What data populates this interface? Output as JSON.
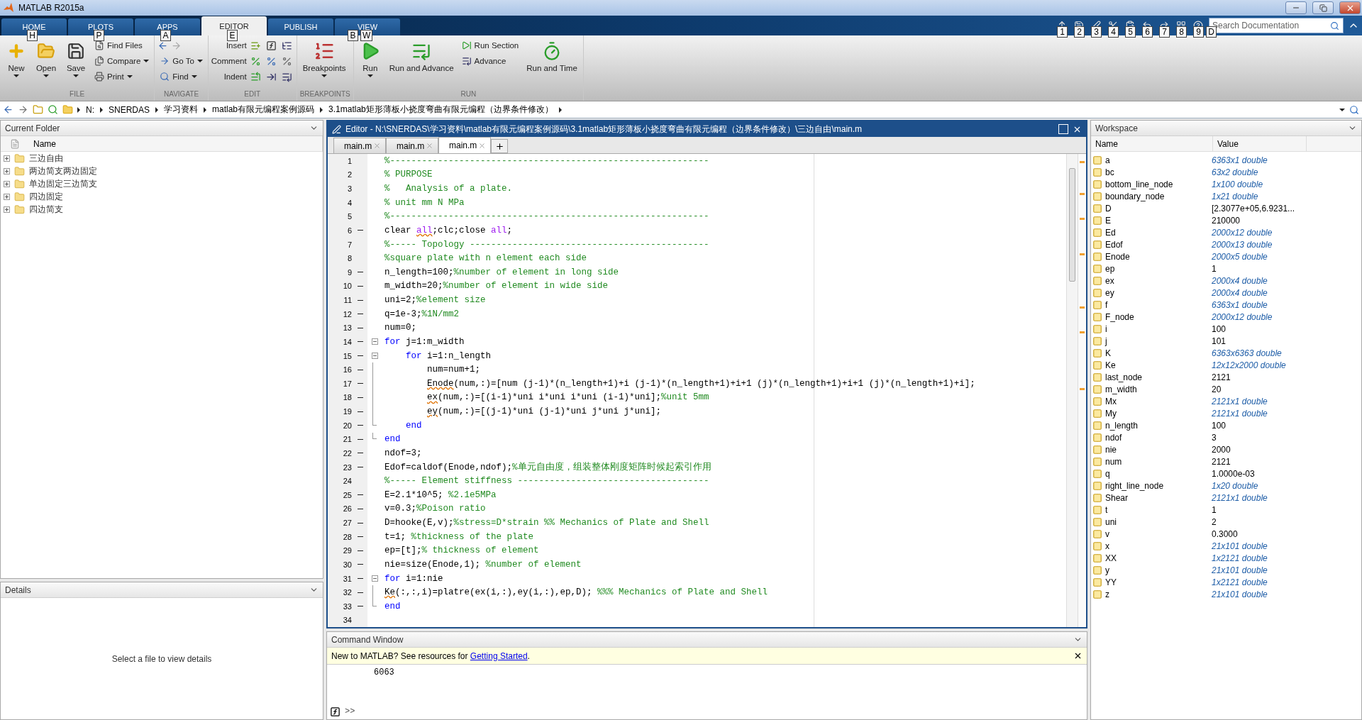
{
  "window": {
    "title": "MATLAB R2015a"
  },
  "ribbon_tabs": [
    {
      "label": "HOME",
      "keytip": "H",
      "selected": false
    },
    {
      "label": "PLOTS",
      "keytip": "P",
      "selected": false
    },
    {
      "label": "APPS",
      "keytip": "A",
      "selected": false
    },
    {
      "label": "EDITOR",
      "keytip": "E",
      "selected": true
    },
    {
      "label": "PUBLISH",
      "keytip": "B",
      "selected": false
    },
    {
      "label": "VIEW",
      "keytip": "W",
      "selected": false
    }
  ],
  "quick_access": {
    "keytips": [
      "1",
      "2",
      "3",
      "4",
      "5",
      "6",
      "7",
      "8",
      "9"
    ],
    "search_placeholder": "Search Documentation",
    "search_keytip": "D"
  },
  "ribbon_groups": [
    {
      "label": "FILE",
      "items": [
        {
          "kind": "large",
          "label": "New",
          "caret": true
        },
        {
          "kind": "large",
          "label": "Open",
          "caret": true
        },
        {
          "kind": "large",
          "label": "Save",
          "caret": true
        },
        {
          "kind": "small",
          "label": "Find Files",
          "caret": false
        },
        {
          "kind": "small",
          "label": "Compare",
          "caret": true
        },
        {
          "kind": "small",
          "label": "Print",
          "caret": true
        }
      ]
    },
    {
      "label": "NAVIGATE",
      "items": [
        {
          "kind": "arrows"
        },
        {
          "kind": "small",
          "label": "Go To",
          "caret": true
        },
        {
          "kind": "small",
          "label": "Find",
          "caret": true
        }
      ]
    },
    {
      "label": "EDIT",
      "items": [
        {
          "kind": "row",
          "label": "Insert"
        },
        {
          "kind": "row",
          "label": "Comment"
        },
        {
          "kind": "row",
          "label": "Indent"
        }
      ]
    },
    {
      "label": "BREAKPOINTS",
      "items": [
        {
          "kind": "large",
          "label": "Breakpoints",
          "caret": true
        }
      ]
    },
    {
      "label": "RUN",
      "items": [
        {
          "kind": "large",
          "label": "Run",
          "caret": true
        },
        {
          "kind": "large",
          "label": "Run and Advance",
          "caret": false
        },
        {
          "kind": "small",
          "label": "Run Section",
          "caret": false
        },
        {
          "kind": "small",
          "label": "Advance",
          "caret": false
        },
        {
          "kind": "large",
          "label": "Run and Time",
          "caret": false
        }
      ]
    }
  ],
  "address_path": [
    "N:",
    "SNERDAS",
    "学习资料",
    "matlab有限元编程案例源码",
    "3.1matlab矩形薄板小挠度弯曲有限元编程（边界条件修改）"
  ],
  "current_folder": {
    "title": "Current Folder",
    "column": "Name",
    "items": [
      {
        "name": "三边自由",
        "expanded": false
      },
      {
        "name": "两边简支两边固定",
        "expanded": false
      },
      {
        "name": "单边固定三边简支",
        "expanded": false
      },
      {
        "name": "四边固定",
        "expanded": false
      },
      {
        "name": "四边简支",
        "expanded": false
      }
    ]
  },
  "details": {
    "title": "Details",
    "message": "Select a file to view details"
  },
  "editor": {
    "title": "Editor - N:\\SNERDAS\\学习资料\\matlab有限元编程案例源码\\3.1matlab矩形薄板小挠度弯曲有限元编程（边界条件修改）\\三边自由\\main.m",
    "tabs": [
      {
        "label": "main.m",
        "selected": false
      },
      {
        "label": "main.m",
        "selected": false
      },
      {
        "label": "main.m",
        "selected": true
      }
    ],
    "lines": [
      {
        "number": "1",
        "kind": "plain",
        "executable": false,
        "segments": [
          {
            "kind": "comment",
            "text": "%------------------------------------------------------------"
          }
        ]
      },
      {
        "number": "2",
        "kind": "plain",
        "executable": false,
        "segments": [
          {
            "kind": "comment",
            "text": "% PURPOSE"
          }
        ]
      },
      {
        "number": "3",
        "kind": "plain",
        "executable": false,
        "segments": [
          {
            "kind": "comment",
            "text": "%   Analysis of a plate."
          }
        ]
      },
      {
        "number": "4",
        "kind": "plain",
        "executable": false,
        "segments": [
          {
            "kind": "comment",
            "text": "% unit mm N MPa"
          }
        ]
      },
      {
        "number": "5",
        "kind": "plain",
        "executable": false,
        "segments": [
          {
            "kind": "comment",
            "text": "%------------------------------------------------------------"
          }
        ]
      },
      {
        "number": "6",
        "kind": "plain",
        "executable": true,
        "segments": [
          {
            "kind": "code",
            "text": "clear "
          },
          {
            "kind": "flagged_string",
            "text": "all"
          },
          {
            "kind": "code",
            "text": ";clc;close "
          },
          {
            "kind": "string",
            "text": "all"
          },
          {
            "kind": "code",
            "text": ";"
          }
        ]
      },
      {
        "number": "7",
        "kind": "plain",
        "executable": false,
        "segments": [
          {
            "kind": "comment",
            "text": "%----- Topology ---------------------------------------------"
          }
        ]
      },
      {
        "number": "8",
        "kind": "plain",
        "executable": false,
        "segments": [
          {
            "kind": "comment",
            "text": "%square plate with n element each side"
          }
        ]
      },
      {
        "number": "9",
        "kind": "plain",
        "executable": true,
        "segments": [
          {
            "kind": "code",
            "text": "n_length=100;"
          },
          {
            "kind": "comment",
            "text": "%number of element in long side"
          }
        ]
      },
      {
        "number": "10",
        "kind": "plain",
        "executable": true,
        "segments": [
          {
            "kind": "code",
            "text": "m_width=20;"
          },
          {
            "kind": "comment",
            "text": "%number of element in wide side"
          }
        ]
      },
      {
        "number": "11",
        "kind": "plain",
        "executable": true,
        "segments": [
          {
            "kind": "code",
            "text": "uni=2;"
          },
          {
            "kind": "comment",
            "text": "%element size"
          }
        ]
      },
      {
        "number": "12",
        "kind": "plain",
        "executable": true,
        "segments": [
          {
            "kind": "code",
            "text": "q=1e-3;"
          },
          {
            "kind": "comment",
            "text": "%1N/mm2"
          }
        ]
      },
      {
        "number": "13",
        "kind": "plain",
        "executable": true,
        "segments": [
          {
            "kind": "code",
            "text": "num=0;"
          }
        ]
      },
      {
        "number": "14",
        "kind": "opener",
        "executable": true,
        "segments": [
          {
            "kind": "keyword",
            "text": "for"
          },
          {
            "kind": "code",
            "text": " j=1:m_width"
          }
        ]
      },
      {
        "number": "15",
        "kind": "opener",
        "executable": true,
        "segments": [
          {
            "kind": "keyword",
            "text": "    for"
          },
          {
            "kind": "code",
            "text": " i=1:n_length"
          }
        ]
      },
      {
        "number": "16",
        "kind": "inner",
        "executable": true,
        "segments": [
          {
            "kind": "code",
            "text": "        num=num+1;"
          }
        ]
      },
      {
        "number": "17",
        "kind": "inner",
        "executable": true,
        "segments": [
          {
            "kind": "flagged",
            "text": "        Enode"
          },
          {
            "kind": "code",
            "text": "(num,:)=[num (j-1)*(n_length+1)+i (j-1)*(n_length+1)+i+1 (j)*(n_length+1)+i+1 (j)*(n_length+1)+i];"
          }
        ]
      },
      {
        "number": "18",
        "kind": "inner",
        "executable": true,
        "segments": [
          {
            "kind": "flagged",
            "text": "        ex"
          },
          {
            "kind": "code",
            "text": "(num,:)=[(i-1)*uni i*uni i*uni (i-1)*uni];"
          },
          {
            "kind": "comment",
            "text": "%unit 5mm"
          }
        ]
      },
      {
        "number": "19",
        "kind": "inner",
        "executable": true,
        "segments": [
          {
            "kind": "flagged",
            "text": "        ey"
          },
          {
            "kind": "code",
            "text": "(num,:)=[(j-1)*uni (j-1)*uni j*uni j*uni];"
          }
        ]
      },
      {
        "number": "20",
        "kind": "closer",
        "executable": true,
        "segments": [
          {
            "kind": "keyword",
            "text": "    end"
          }
        ]
      },
      {
        "number": "21",
        "kind": "closer",
        "executable": true,
        "segments": [
          {
            "kind": "keyword",
            "text": "end"
          }
        ]
      },
      {
        "number": "22",
        "kind": "plain",
        "executable": true,
        "segments": [
          {
            "kind": "code",
            "text": "ndof=3;"
          }
        ]
      },
      {
        "number": "23",
        "kind": "plain",
        "executable": true,
        "segments": [
          {
            "kind": "code",
            "text": "Edof=caldof(Enode,ndof);"
          },
          {
            "kind": "comment",
            "text": "%单元自由度，组装整体刚度矩阵时候起索引作用"
          }
        ]
      },
      {
        "number": "24",
        "kind": "plain",
        "executable": false,
        "segments": [
          {
            "kind": "comment",
            "text": "%----- Element stiffness ------------------------------------"
          }
        ]
      },
      {
        "number": "25",
        "kind": "plain",
        "executable": true,
        "segments": [
          {
            "kind": "code",
            "text": "E=2.1*10^5; "
          },
          {
            "kind": "comment",
            "text": "%2.1e5MPa"
          }
        ]
      },
      {
        "number": "26",
        "kind": "plain",
        "executable": true,
        "segments": [
          {
            "kind": "code",
            "text": "v=0.3;"
          },
          {
            "kind": "comment",
            "text": "%Poison ratio"
          }
        ]
      },
      {
        "number": "27",
        "kind": "plain",
        "executable": true,
        "segments": [
          {
            "kind": "code",
            "text": "D=hooke(E,v);"
          },
          {
            "kind": "comment",
            "text": "%stress=D*strain %% Mechanics of Plate and Shell"
          }
        ]
      },
      {
        "number": "28",
        "kind": "plain",
        "executable": true,
        "segments": [
          {
            "kind": "code",
            "text": "t=1; "
          },
          {
            "kind": "comment",
            "text": "%thickness of the plate"
          }
        ]
      },
      {
        "number": "29",
        "kind": "plain",
        "executable": true,
        "segments": [
          {
            "kind": "code",
            "text": "ep=[t];"
          },
          {
            "kind": "comment",
            "text": "% thickness of element"
          }
        ]
      },
      {
        "number": "30",
        "kind": "plain",
        "executable": true,
        "segments": [
          {
            "kind": "code",
            "text": "nie=size(Enode,1); "
          },
          {
            "kind": "comment",
            "text": "%number of element"
          }
        ]
      },
      {
        "number": "31",
        "kind": "opener",
        "executable": true,
        "segments": [
          {
            "kind": "keyword",
            "text": "for"
          },
          {
            "kind": "code",
            "text": " i=1:nie"
          }
        ]
      },
      {
        "number": "32",
        "kind": "inner",
        "executable": true,
        "segments": [
          {
            "kind": "flagged",
            "text": "Ke"
          },
          {
            "kind": "code",
            "text": "(:,:,i)=platre(ex(i,:),ey(i,:),ep,D); "
          },
          {
            "kind": "comment",
            "text": "%%% Mechanics of Plate and Shell"
          }
        ]
      },
      {
        "number": "33",
        "kind": "closer",
        "executable": true,
        "segments": [
          {
            "kind": "keyword",
            "text": "end"
          }
        ]
      },
      {
        "number": "34",
        "kind": "plain",
        "executable": false
      }
    ]
  },
  "command_window": {
    "title": "Command Window",
    "banner_text": "New to MATLAB? See resources for ",
    "banner_link": "Getting Started",
    "banner_end": ".",
    "output": [
      "6063"
    ],
    "prompt": ">>"
  },
  "workspace": {
    "title": "Workspace",
    "columns": [
      "Name",
      "Value"
    ],
    "rows": [
      {
        "name": "a",
        "value": "6363x1 double",
        "kind": "array"
      },
      {
        "name": "bc",
        "value": "63x2 double",
        "kind": "array"
      },
      {
        "name": "bottom_line_node",
        "value": "1x100 double",
        "kind": "array"
      },
      {
        "name": "boundary_node",
        "value": "1x21 double",
        "kind": "array"
      },
      {
        "name": "D",
        "value": "[2.3077e+05,6.9231...",
        "kind": "scalar"
      },
      {
        "name": "E",
        "value": "210000",
        "kind": "scalar"
      },
      {
        "name": "Ed",
        "value": "2000x12 double",
        "kind": "array"
      },
      {
        "name": "Edof",
        "value": "2000x13 double",
        "kind": "array"
      },
      {
        "name": "Enode",
        "value": "2000x5 double",
        "kind": "array"
      },
      {
        "name": "ep",
        "value": "1",
        "kind": "scalar"
      },
      {
        "name": "ex",
        "value": "2000x4 double",
        "kind": "array"
      },
      {
        "name": "ey",
        "value": "2000x4 double",
        "kind": "array"
      },
      {
        "name": "f",
        "value": "6363x1 double",
        "kind": "array"
      },
      {
        "name": "F_node",
        "value": "2000x12 double",
        "kind": "array"
      },
      {
        "name": "i",
        "value": "100",
        "kind": "scalar"
      },
      {
        "name": "j",
        "value": "101",
        "kind": "scalar"
      },
      {
        "name": "K",
        "value": "6363x6363 double",
        "kind": "array"
      },
      {
        "name": "Ke",
        "value": "12x12x2000 double",
        "kind": "array"
      },
      {
        "name": "last_node",
        "value": "2121",
        "kind": "scalar"
      },
      {
        "name": "m_width",
        "value": "20",
        "kind": "scalar"
      },
      {
        "name": "Mx",
        "value": "2121x1 double",
        "kind": "array"
      },
      {
        "name": "My",
        "value": "2121x1 double",
        "kind": "array"
      },
      {
        "name": "n_length",
        "value": "100",
        "kind": "scalar"
      },
      {
        "name": "ndof",
        "value": "3",
        "kind": "scalar"
      },
      {
        "name": "nie",
        "value": "2000",
        "kind": "scalar"
      },
      {
        "name": "num",
        "value": "2121",
        "kind": "scalar"
      },
      {
        "name": "q",
        "value": "1.0000e-03",
        "kind": "scalar"
      },
      {
        "name": "right_line_node",
        "value": "1x20 double",
        "kind": "array"
      },
      {
        "name": "Shear",
        "value": "2121x1 double",
        "kind": "array"
      },
      {
        "name": "t",
        "value": "1",
        "kind": "scalar"
      },
      {
        "name": "uni",
        "value": "2",
        "kind": "scalar"
      },
      {
        "name": "v",
        "value": "0.3000",
        "kind": "scalar"
      },
      {
        "name": "x",
        "value": "21x101 double",
        "kind": "array"
      },
      {
        "name": "XX",
        "value": "1x2121 double",
        "kind": "array"
      },
      {
        "name": "y",
        "value": "21x101 double",
        "kind": "array"
      },
      {
        "name": "YY",
        "value": "1x2121 double",
        "kind": "array"
      },
      {
        "name": "z",
        "value": "21x101 double",
        "kind": "array"
      }
    ]
  }
}
